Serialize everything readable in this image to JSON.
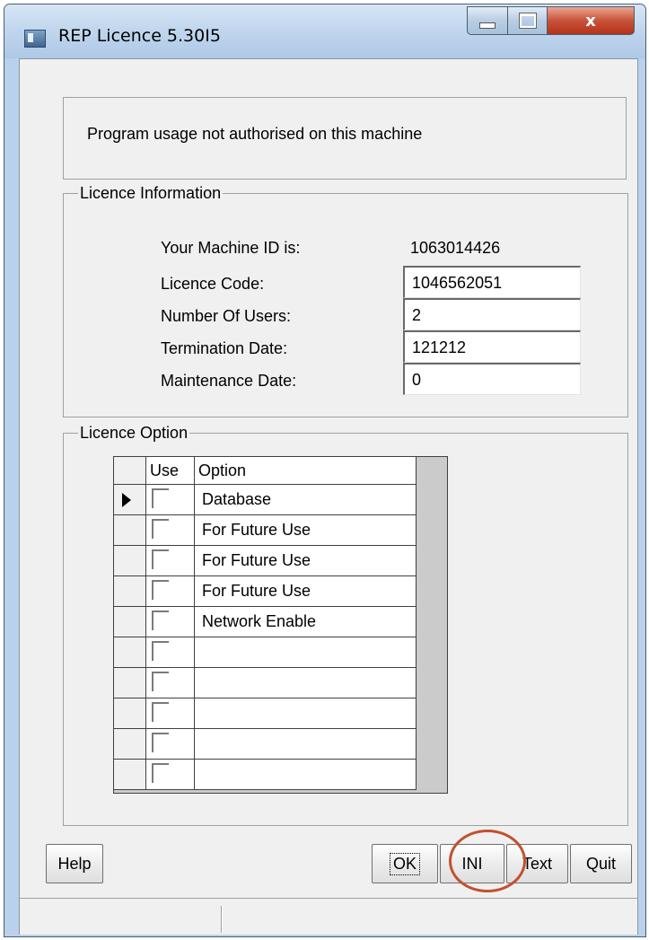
{
  "window": {
    "title": "REP Licence 5.30I5",
    "close_glyph": "x"
  },
  "message": "Program usage not authorised on this machine",
  "licence_info": {
    "legend": "Licence Information",
    "machine_id_label": "Your Machine ID is:",
    "machine_id_value": "1063014426",
    "licence_code_label": "Licence Code:",
    "licence_code_value": "1046562051",
    "users_label": "Number Of Users:",
    "users_value": "2",
    "termination_label": "Termination Date:",
    "termination_value": "121212",
    "maintenance_label": "Maintenance Date:",
    "maintenance_value": "0"
  },
  "licence_option": {
    "legend": "Licence Option",
    "columns": [
      "Use",
      "Option"
    ],
    "rows": [
      {
        "option": "Database",
        "checked": false,
        "current": true
      },
      {
        "option": "For Future Use",
        "checked": false,
        "current": false
      },
      {
        "option": "For Future Use",
        "checked": false,
        "current": false
      },
      {
        "option": "For Future Use",
        "checked": false,
        "current": false
      },
      {
        "option": "Network Enable",
        "checked": false,
        "current": false
      },
      {
        "option": "",
        "checked": false,
        "current": false
      },
      {
        "option": "",
        "checked": false,
        "current": false
      },
      {
        "option": "",
        "checked": false,
        "current": false
      },
      {
        "option": "",
        "checked": false,
        "current": false
      },
      {
        "option": "",
        "checked": false,
        "current": false
      }
    ]
  },
  "buttons": {
    "help": "Help",
    "ok": "OK",
    "ini": "INI",
    "text": "Text",
    "quit": "Quit"
  },
  "colors": {
    "annotation": "#c0522f",
    "close_button": "#c8533a"
  }
}
